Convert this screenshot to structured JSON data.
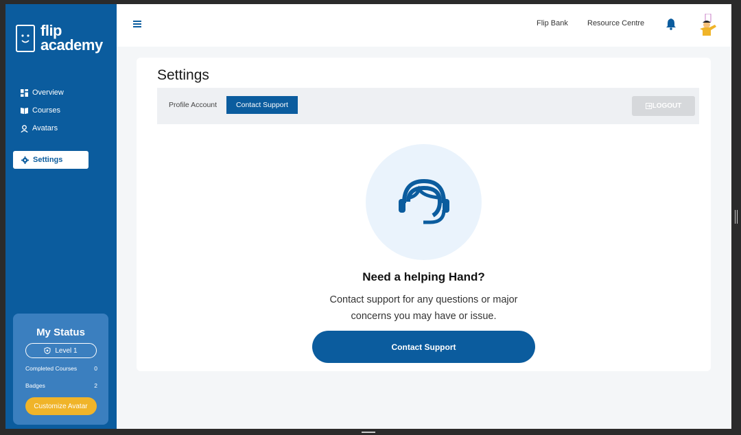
{
  "brand": {
    "line1": "flip",
    "line2": "academy"
  },
  "sidebar": {
    "items": [
      {
        "label": "Overview",
        "icon": "dashboard-icon"
      },
      {
        "label": "Courses",
        "icon": "book-icon"
      },
      {
        "label": "Avatars",
        "icon": "user-icon"
      }
    ],
    "settings_label": "Settings"
  },
  "status": {
    "title": "My Status",
    "level": "Level 1",
    "completed_label": "Completed Courses",
    "completed_value": "0",
    "badges_label": "Badges",
    "badges_value": "2",
    "customize_label": "Customize Avatar"
  },
  "topbar": {
    "link1": "Flip Bank",
    "link2": "Resource Centre"
  },
  "page": {
    "title": "Settings",
    "tab_profile": "Profile Account",
    "tab_contact": "Contact Support",
    "logout_label": "LOGOUT",
    "help_title": "Need a helping Hand?",
    "help_desc": "Contact support for any questions or major concerns you may have or issue.",
    "contact_button": "Contact Support"
  },
  "colors": {
    "primary": "#0b5c9e",
    "accent": "#f0b429",
    "light": "#eaf3fc"
  }
}
